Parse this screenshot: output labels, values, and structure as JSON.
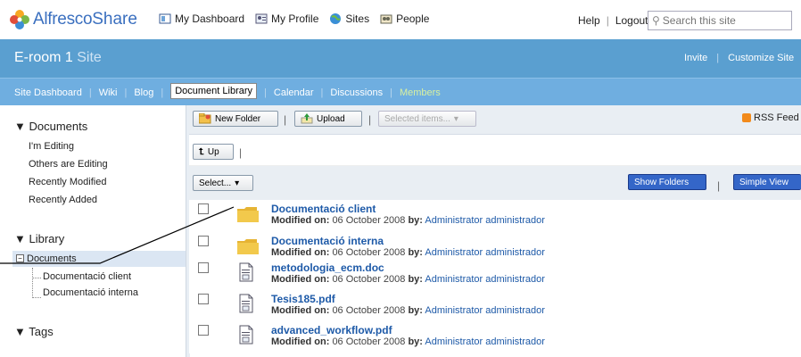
{
  "app": {
    "brand_part1": "Alfresco",
    "brand_part2": "Share"
  },
  "topnav": [
    {
      "label": "My Dashboard",
      "icon": "dashboard-icon"
    },
    {
      "label": "My Profile",
      "icon": "profile-icon"
    },
    {
      "label": "Sites",
      "icon": "sites-icon"
    },
    {
      "label": "People",
      "icon": "people-icon"
    }
  ],
  "topright": {
    "help": "Help",
    "logout": "Logout",
    "search_placeholder": "Search this site"
  },
  "site": {
    "title": "E-room 1",
    "subtitle": "Site",
    "invite": "Invite",
    "customize": "Customize Site"
  },
  "sitenav": [
    "Site Dashboard",
    "Wiki",
    "Blog",
    "Document Library",
    "Calendar",
    "Discussions",
    "Members"
  ],
  "left": {
    "documents_heading": "▼ Documents",
    "doc_links": [
      "I'm Editing",
      "Others are Editing",
      "Recently Modified",
      "Recently Added"
    ],
    "library_heading": "▼ Library",
    "tree_root": "Documents",
    "tree_children": [
      "Documentació client",
      "Documentació interna"
    ],
    "tags_heading": "▼ Tags"
  },
  "toolbar": {
    "new_folder": "New Folder",
    "upload": "Upload",
    "selected_items": "Selected items...",
    "rss": "RSS Feed"
  },
  "upbar": {
    "up": "Up"
  },
  "selbar": {
    "select": "Select...",
    "show_folders": "Show Folders",
    "simple_view": "Simple View"
  },
  "labels": {
    "modified_on": "Modified on:",
    "by": "by:"
  },
  "rows": [
    {
      "name": "Documentació client",
      "type": "folder",
      "date": "06 October 2008",
      "user": "Administrator administrador"
    },
    {
      "name": "Documentació interna",
      "type": "folder",
      "date": "06 October 2008",
      "user": "Administrator administrador"
    },
    {
      "name": "metodologia_ecm.doc",
      "type": "doc",
      "date": "06 October 2008",
      "user": "Administrator administrador"
    },
    {
      "name": "Tesis185.pdf",
      "type": "doc",
      "date": "06 October 2008",
      "user": "Administrator administrador"
    },
    {
      "name": "advanced_workflow.pdf",
      "type": "doc",
      "date": "06 October 2008",
      "user": "Administrator administrador"
    }
  ],
  "colors": {
    "site_header": "#5a9fd0",
    "site_nav": "#6faee0",
    "link": "#1e5aa8",
    "blue_button": "#3466c8"
  }
}
